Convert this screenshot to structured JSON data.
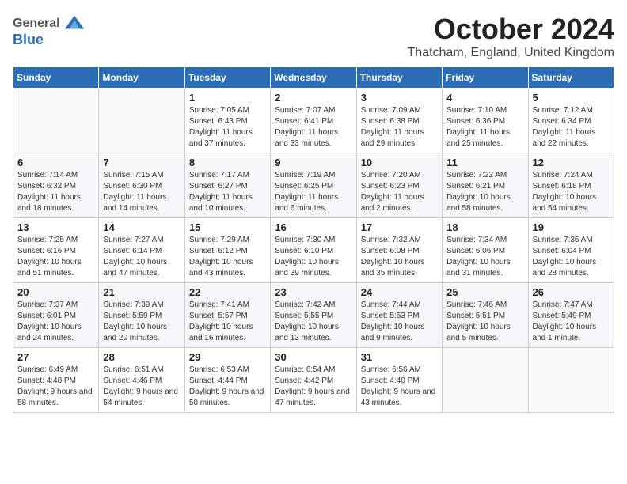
{
  "logo": {
    "general": "General",
    "blue": "Blue"
  },
  "title": "October 2024",
  "location": "Thatcham, England, United Kingdom",
  "days_of_week": [
    "Sunday",
    "Monday",
    "Tuesday",
    "Wednesday",
    "Thursday",
    "Friday",
    "Saturday"
  ],
  "weeks": [
    [
      {
        "day": "",
        "content": ""
      },
      {
        "day": "",
        "content": ""
      },
      {
        "day": "1",
        "content": "Sunrise: 7:05 AM\nSunset: 6:43 PM\nDaylight: 11 hours and 37 minutes."
      },
      {
        "day": "2",
        "content": "Sunrise: 7:07 AM\nSunset: 6:41 PM\nDaylight: 11 hours and 33 minutes."
      },
      {
        "day": "3",
        "content": "Sunrise: 7:09 AM\nSunset: 6:38 PM\nDaylight: 11 hours and 29 minutes."
      },
      {
        "day": "4",
        "content": "Sunrise: 7:10 AM\nSunset: 6:36 PM\nDaylight: 11 hours and 25 minutes."
      },
      {
        "day": "5",
        "content": "Sunrise: 7:12 AM\nSunset: 6:34 PM\nDaylight: 11 hours and 22 minutes."
      }
    ],
    [
      {
        "day": "6",
        "content": "Sunrise: 7:14 AM\nSunset: 6:32 PM\nDaylight: 11 hours and 18 minutes."
      },
      {
        "day": "7",
        "content": "Sunrise: 7:15 AM\nSunset: 6:30 PM\nDaylight: 11 hours and 14 minutes."
      },
      {
        "day": "8",
        "content": "Sunrise: 7:17 AM\nSunset: 6:27 PM\nDaylight: 11 hours and 10 minutes."
      },
      {
        "day": "9",
        "content": "Sunrise: 7:19 AM\nSunset: 6:25 PM\nDaylight: 11 hours and 6 minutes."
      },
      {
        "day": "10",
        "content": "Sunrise: 7:20 AM\nSunset: 6:23 PM\nDaylight: 11 hours and 2 minutes."
      },
      {
        "day": "11",
        "content": "Sunrise: 7:22 AM\nSunset: 6:21 PM\nDaylight: 10 hours and 58 minutes."
      },
      {
        "day": "12",
        "content": "Sunrise: 7:24 AM\nSunset: 6:18 PM\nDaylight: 10 hours and 54 minutes."
      }
    ],
    [
      {
        "day": "13",
        "content": "Sunrise: 7:25 AM\nSunset: 6:16 PM\nDaylight: 10 hours and 51 minutes."
      },
      {
        "day": "14",
        "content": "Sunrise: 7:27 AM\nSunset: 6:14 PM\nDaylight: 10 hours and 47 minutes."
      },
      {
        "day": "15",
        "content": "Sunrise: 7:29 AM\nSunset: 6:12 PM\nDaylight: 10 hours and 43 minutes."
      },
      {
        "day": "16",
        "content": "Sunrise: 7:30 AM\nSunset: 6:10 PM\nDaylight: 10 hours and 39 minutes."
      },
      {
        "day": "17",
        "content": "Sunrise: 7:32 AM\nSunset: 6:08 PM\nDaylight: 10 hours and 35 minutes."
      },
      {
        "day": "18",
        "content": "Sunrise: 7:34 AM\nSunset: 6:06 PM\nDaylight: 10 hours and 31 minutes."
      },
      {
        "day": "19",
        "content": "Sunrise: 7:35 AM\nSunset: 6:04 PM\nDaylight: 10 hours and 28 minutes."
      }
    ],
    [
      {
        "day": "20",
        "content": "Sunrise: 7:37 AM\nSunset: 6:01 PM\nDaylight: 10 hours and 24 minutes."
      },
      {
        "day": "21",
        "content": "Sunrise: 7:39 AM\nSunset: 5:59 PM\nDaylight: 10 hours and 20 minutes."
      },
      {
        "day": "22",
        "content": "Sunrise: 7:41 AM\nSunset: 5:57 PM\nDaylight: 10 hours and 16 minutes."
      },
      {
        "day": "23",
        "content": "Sunrise: 7:42 AM\nSunset: 5:55 PM\nDaylight: 10 hours and 13 minutes."
      },
      {
        "day": "24",
        "content": "Sunrise: 7:44 AM\nSunset: 5:53 PM\nDaylight: 10 hours and 9 minutes."
      },
      {
        "day": "25",
        "content": "Sunrise: 7:46 AM\nSunset: 5:51 PM\nDaylight: 10 hours and 5 minutes."
      },
      {
        "day": "26",
        "content": "Sunrise: 7:47 AM\nSunset: 5:49 PM\nDaylight: 10 hours and 1 minute."
      }
    ],
    [
      {
        "day": "27",
        "content": "Sunrise: 6:49 AM\nSunset: 4:48 PM\nDaylight: 9 hours and 58 minutes."
      },
      {
        "day": "28",
        "content": "Sunrise: 6:51 AM\nSunset: 4:46 PM\nDaylight: 9 hours and 54 minutes."
      },
      {
        "day": "29",
        "content": "Sunrise: 6:53 AM\nSunset: 4:44 PM\nDaylight: 9 hours and 50 minutes."
      },
      {
        "day": "30",
        "content": "Sunrise: 6:54 AM\nSunset: 4:42 PM\nDaylight: 9 hours and 47 minutes."
      },
      {
        "day": "31",
        "content": "Sunrise: 6:56 AM\nSunset: 4:40 PM\nDaylight: 9 hours and 43 minutes."
      },
      {
        "day": "",
        "content": ""
      },
      {
        "day": "",
        "content": ""
      }
    ]
  ]
}
